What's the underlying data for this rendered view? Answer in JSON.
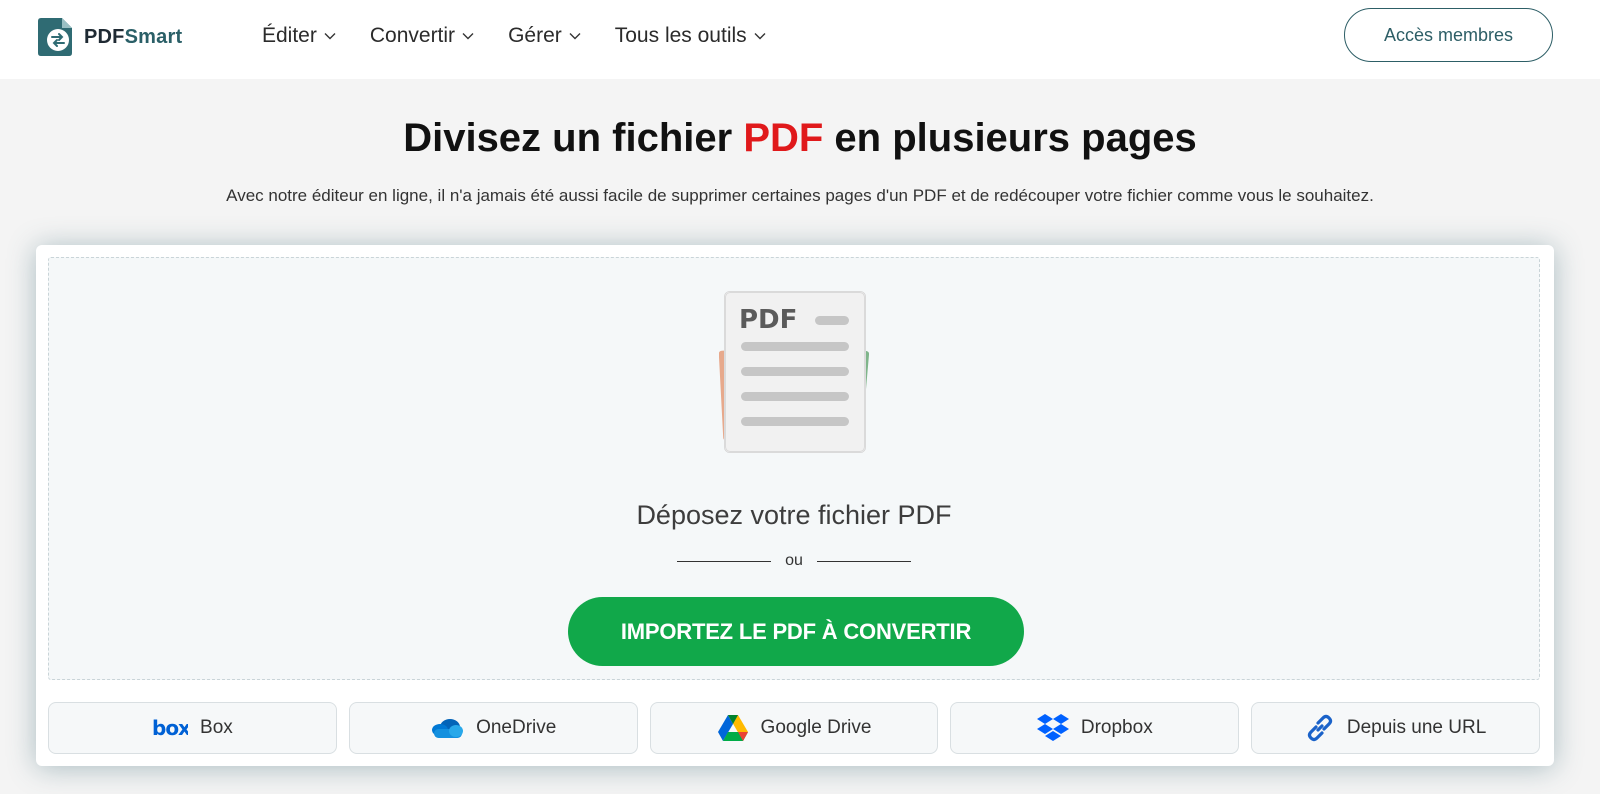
{
  "header": {
    "logo": {
      "text_bold": "PDF",
      "text_accent": "Smart",
      "icon": "pdfsmart-logo-icon"
    },
    "nav": [
      {
        "label": "Éditer",
        "icon": "chevron-down-icon"
      },
      {
        "label": "Convertir",
        "icon": "chevron-down-icon"
      },
      {
        "label": "Gérer",
        "icon": "chevron-down-icon"
      },
      {
        "label": "Tous les outils",
        "icon": "chevron-down-icon"
      }
    ],
    "members_button": "Accès membres"
  },
  "hero": {
    "title_part1": "Divisez un fichier ",
    "title_accent": "PDF",
    "title_part2": " en plusieurs pages",
    "subtitle": "Avec notre éditeur en ligne, il n'a jamais été aussi facile de supprimer certaines pages d'un PDF et de redécouper votre fichier comme vous le souhaitez."
  },
  "upload": {
    "illustration_label": "PDF",
    "drop_text": "Déposez votre fichier PDF",
    "or_text": "ou",
    "import_button": "IMPORTEZ LE PDF À CONVERTIR"
  },
  "sources": [
    {
      "label": "Box",
      "icon": "box-logo-icon"
    },
    {
      "label": "OneDrive",
      "icon": "onedrive-cloud-icon"
    },
    {
      "label": "Google Drive",
      "icon": "google-drive-icon"
    },
    {
      "label": "Dropbox",
      "icon": "dropbox-icon"
    },
    {
      "label": "Depuis une URL",
      "icon": "link-icon"
    }
  ],
  "colors": {
    "accent_red": "#e0191b",
    "brand_teal": "#2d5e66",
    "import_green": "#11a84a"
  }
}
